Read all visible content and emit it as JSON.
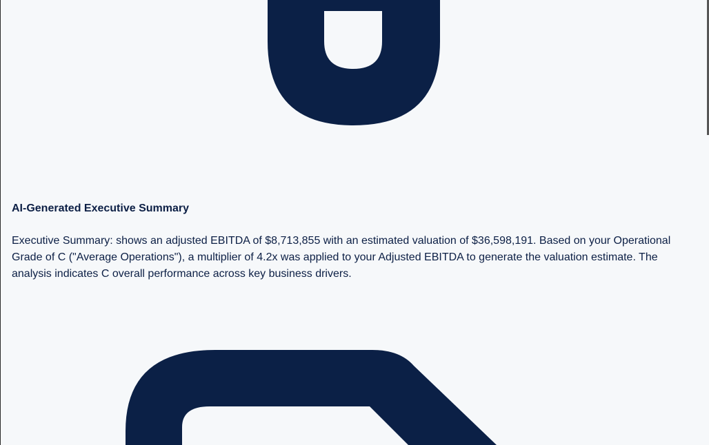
{
  "summary": {
    "title": "AI-Generated Executive Summary",
    "body": "Executive Summary: shows an adjusted EBITDA of $8,713,855 with an estimated valuation of $36,598,191. Based on your Operational Grade of C (\"Average Operations\"), a multiplier of 4.2x was applied to your Adjusted EBITDA to generate the valuation estimate. The analysis indicates C overall performance across key business drivers."
  },
  "icons": {
    "top": "lock-shackle-icon",
    "bottom": "lock-body-icon",
    "color": "#0b2046"
  },
  "colors": {
    "background": "#f6f8fa",
    "text": "#0c1f45"
  }
}
